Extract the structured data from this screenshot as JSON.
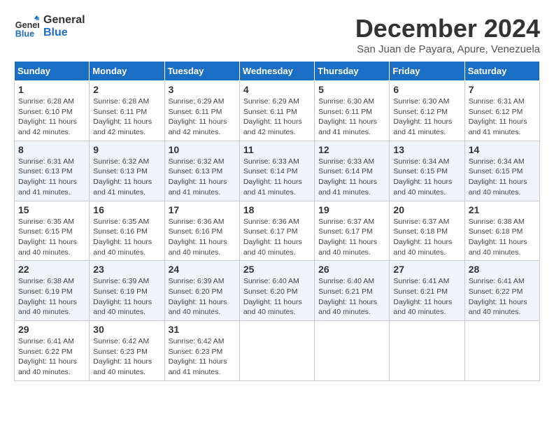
{
  "header": {
    "logo_line1": "General",
    "logo_line2": "Blue",
    "month_title": "December 2024",
    "subtitle": "San Juan de Payara, Apure, Venezuela"
  },
  "weekdays": [
    "Sunday",
    "Monday",
    "Tuesday",
    "Wednesday",
    "Thursday",
    "Friday",
    "Saturday"
  ],
  "weeks": [
    [
      {
        "day": "1",
        "info": "Sunrise: 6:28 AM\nSunset: 6:10 PM\nDaylight: 11 hours\nand 42 minutes."
      },
      {
        "day": "2",
        "info": "Sunrise: 6:28 AM\nSunset: 6:11 PM\nDaylight: 11 hours\nand 42 minutes."
      },
      {
        "day": "3",
        "info": "Sunrise: 6:29 AM\nSunset: 6:11 PM\nDaylight: 11 hours\nand 42 minutes."
      },
      {
        "day": "4",
        "info": "Sunrise: 6:29 AM\nSunset: 6:11 PM\nDaylight: 11 hours\nand 42 minutes."
      },
      {
        "day": "5",
        "info": "Sunrise: 6:30 AM\nSunset: 6:11 PM\nDaylight: 11 hours\nand 41 minutes."
      },
      {
        "day": "6",
        "info": "Sunrise: 6:30 AM\nSunset: 6:12 PM\nDaylight: 11 hours\nand 41 minutes."
      },
      {
        "day": "7",
        "info": "Sunrise: 6:31 AM\nSunset: 6:12 PM\nDaylight: 11 hours\nand 41 minutes."
      }
    ],
    [
      {
        "day": "8",
        "info": "Sunrise: 6:31 AM\nSunset: 6:13 PM\nDaylight: 11 hours\nand 41 minutes."
      },
      {
        "day": "9",
        "info": "Sunrise: 6:32 AM\nSunset: 6:13 PM\nDaylight: 11 hours\nand 41 minutes."
      },
      {
        "day": "10",
        "info": "Sunrise: 6:32 AM\nSunset: 6:13 PM\nDaylight: 11 hours\nand 41 minutes."
      },
      {
        "day": "11",
        "info": "Sunrise: 6:33 AM\nSunset: 6:14 PM\nDaylight: 11 hours\nand 41 minutes."
      },
      {
        "day": "12",
        "info": "Sunrise: 6:33 AM\nSunset: 6:14 PM\nDaylight: 11 hours\nand 41 minutes."
      },
      {
        "day": "13",
        "info": "Sunrise: 6:34 AM\nSunset: 6:15 PM\nDaylight: 11 hours\nand 40 minutes."
      },
      {
        "day": "14",
        "info": "Sunrise: 6:34 AM\nSunset: 6:15 PM\nDaylight: 11 hours\nand 40 minutes."
      }
    ],
    [
      {
        "day": "15",
        "info": "Sunrise: 6:35 AM\nSunset: 6:15 PM\nDaylight: 11 hours\nand 40 minutes."
      },
      {
        "day": "16",
        "info": "Sunrise: 6:35 AM\nSunset: 6:16 PM\nDaylight: 11 hours\nand 40 minutes."
      },
      {
        "day": "17",
        "info": "Sunrise: 6:36 AM\nSunset: 6:16 PM\nDaylight: 11 hours\nand 40 minutes."
      },
      {
        "day": "18",
        "info": "Sunrise: 6:36 AM\nSunset: 6:17 PM\nDaylight: 11 hours\nand 40 minutes."
      },
      {
        "day": "19",
        "info": "Sunrise: 6:37 AM\nSunset: 6:17 PM\nDaylight: 11 hours\nand 40 minutes."
      },
      {
        "day": "20",
        "info": "Sunrise: 6:37 AM\nSunset: 6:18 PM\nDaylight: 11 hours\nand 40 minutes."
      },
      {
        "day": "21",
        "info": "Sunrise: 6:38 AM\nSunset: 6:18 PM\nDaylight: 11 hours\nand 40 minutes."
      }
    ],
    [
      {
        "day": "22",
        "info": "Sunrise: 6:38 AM\nSunset: 6:19 PM\nDaylight: 11 hours\nand 40 minutes."
      },
      {
        "day": "23",
        "info": "Sunrise: 6:39 AM\nSunset: 6:19 PM\nDaylight: 11 hours\nand 40 minutes."
      },
      {
        "day": "24",
        "info": "Sunrise: 6:39 AM\nSunset: 6:20 PM\nDaylight: 11 hours\nand 40 minutes."
      },
      {
        "day": "25",
        "info": "Sunrise: 6:40 AM\nSunset: 6:20 PM\nDaylight: 11 hours\nand 40 minutes."
      },
      {
        "day": "26",
        "info": "Sunrise: 6:40 AM\nSunset: 6:21 PM\nDaylight: 11 hours\nand 40 minutes."
      },
      {
        "day": "27",
        "info": "Sunrise: 6:41 AM\nSunset: 6:21 PM\nDaylight: 11 hours\nand 40 minutes."
      },
      {
        "day": "28",
        "info": "Sunrise: 6:41 AM\nSunset: 6:22 PM\nDaylight: 11 hours\nand 40 minutes."
      }
    ],
    [
      {
        "day": "29",
        "info": "Sunrise: 6:41 AM\nSunset: 6:22 PM\nDaylight: 11 hours\nand 40 minutes."
      },
      {
        "day": "30",
        "info": "Sunrise: 6:42 AM\nSunset: 6:23 PM\nDaylight: 11 hours\nand 40 minutes."
      },
      {
        "day": "31",
        "info": "Sunrise: 6:42 AM\nSunset: 6:23 PM\nDaylight: 11 hours\nand 41 minutes."
      },
      {
        "day": "",
        "info": ""
      },
      {
        "day": "",
        "info": ""
      },
      {
        "day": "",
        "info": ""
      },
      {
        "day": "",
        "info": ""
      }
    ]
  ]
}
